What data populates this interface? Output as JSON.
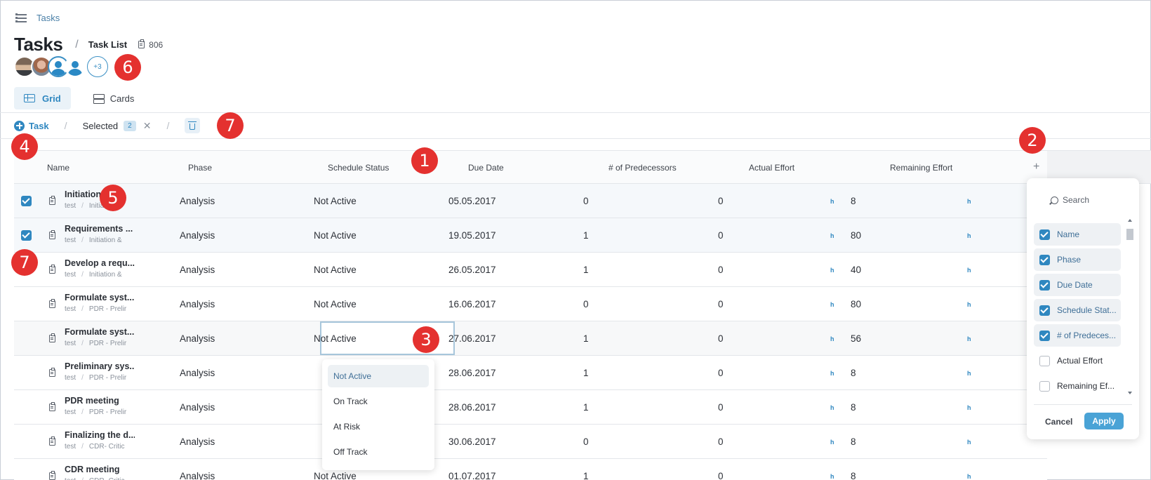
{
  "breadcrumb": {
    "link": "Tasks"
  },
  "header": {
    "title": "Tasks",
    "subtitle": "Task List",
    "count": "806",
    "more_avatars": "+3"
  },
  "views": [
    {
      "label": "Grid",
      "active": true
    },
    {
      "label": "Cards",
      "active": false
    }
  ],
  "toolbar": {
    "add_task_label": "Task",
    "selected_label": "Selected",
    "selected_count": "2"
  },
  "callouts": [
    "1",
    "2",
    "3",
    "4",
    "5",
    "6",
    "7",
    "7"
  ],
  "columns": [
    "Name",
    "Phase",
    "Schedule Status",
    "Due Date",
    "# of Predecessors",
    "Actual Effort",
    "Remaining Effort"
  ],
  "unit": "h",
  "rows": [
    {
      "name": "Initiation ...",
      "project": "test",
      "path": "Initiation &",
      "phase": "Analysis",
      "status": "Not Active",
      "due": "05.05.2017",
      "pred": "0",
      "actual": "0",
      "remaining": "8",
      "selected": true
    },
    {
      "name": "Requirements ...",
      "project": "test",
      "path": "Initiation &",
      "phase": "Analysis",
      "status": "Not Active",
      "due": "19.05.2017",
      "pred": "1",
      "actual": "0",
      "remaining": "80",
      "selected": true
    },
    {
      "name": "Develop a requ...",
      "project": "test",
      "path": "Initiation &",
      "phase": "Analysis",
      "status": "Not Active",
      "due": "26.05.2017",
      "pred": "1",
      "actual": "0",
      "remaining": "40",
      "selected": false
    },
    {
      "name": "Formulate syst...",
      "project": "test",
      "path": "PDR - Prelir",
      "phase": "Analysis",
      "status": "Not Active",
      "due": "16.06.2017",
      "pred": "0",
      "actual": "0",
      "remaining": "80",
      "selected": false
    },
    {
      "name": "Formulate syst...",
      "project": "test",
      "path": "PDR - Prelir",
      "phase": "Analysis",
      "status": "Not Active",
      "due": "27.06.2017",
      "pred": "1",
      "actual": "0",
      "remaining": "56",
      "selected": false
    },
    {
      "name": "Preliminary sys...",
      "project": "test",
      "path": "PDR - Prelir",
      "phase": "Analysis",
      "status": "",
      "due": "28.06.2017",
      "pred": "1",
      "actual": "0",
      "remaining": "8",
      "selected": false
    },
    {
      "name": "PDR meeting",
      "project": "test",
      "path": "PDR - Prelir",
      "phase": "Analysis",
      "status": "",
      "due": "28.06.2017",
      "pred": "1",
      "actual": "0",
      "remaining": "8",
      "selected": false
    },
    {
      "name": "Finalizing the d...",
      "project": "test",
      "path": "CDR- Critic",
      "phase": "Analysis",
      "status": "",
      "due": "30.06.2017",
      "pred": "0",
      "actual": "0",
      "remaining": "8",
      "selected": false
    },
    {
      "name": "CDR meeting",
      "project": "test",
      "path": "CDR- Critic",
      "phase": "Analysis",
      "status": "Not Active",
      "due": "01.07.2017",
      "pred": "1",
      "actual": "0",
      "remaining": "8",
      "selected": false
    }
  ],
  "status_menu": [
    "Not Active",
    "On Track",
    "At Risk",
    "Off Track"
  ],
  "column_panel": {
    "search_placeholder": "Search",
    "items": [
      {
        "label": "Name",
        "checked": true
      },
      {
        "label": "Phase",
        "checked": true
      },
      {
        "label": "Due Date",
        "checked": true
      },
      {
        "label": "Schedule Stat...",
        "checked": true
      },
      {
        "label": "# of Predeces...",
        "checked": true
      },
      {
        "label": "Actual Effort",
        "checked": false
      },
      {
        "label": "Remaining Ef...",
        "checked": false
      }
    ],
    "cancel_label": "Cancel",
    "apply_label": "Apply"
  }
}
